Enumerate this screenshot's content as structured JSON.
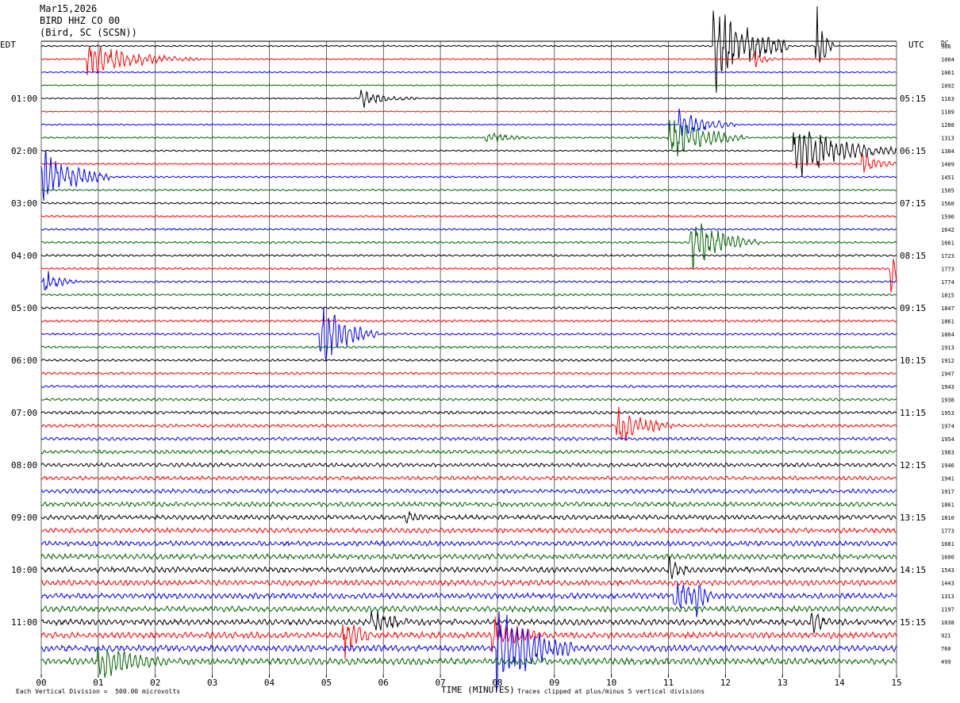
{
  "header": {
    "date": "Mar15,2026",
    "station": "BIRD HHZ CO 00",
    "location": "(Bird, SC (SCSN))"
  },
  "footer": {
    "scale_note": "Each Vertical Division =  500.00 microvolts",
    "clip_note": "Traces clipped at plus/minus 5 vertical divisions",
    "xlabel": "TIME (MINUTES)"
  },
  "colors": {
    "trace_cycle": [
      "#000000",
      "#ff0000",
      "#0000ff",
      "#006400"
    ],
    "grid": "#000000"
  },
  "chart_data": {
    "type": "helicorder",
    "left_axis_label": "EDT",
    "right_axis_label": "UTC",
    "dc_label": "DC",
    "x_ticks": [
      "00",
      "01",
      "02",
      "03",
      "04",
      "05",
      "06",
      "07",
      "08",
      "09",
      "10",
      "11",
      "12",
      "13",
      "14",
      "15"
    ],
    "xlim": [
      0,
      15
    ],
    "minutes_per_line": 15,
    "left_hour_labels": [
      "01:00",
      "02:00",
      "03:00",
      "04:00",
      "05:00",
      "06:00",
      "07:00",
      "08:00",
      "09:00",
      "10:00",
      "11:00"
    ],
    "right_hour_labels": [
      "05:15",
      "06:15",
      "07:15",
      "08:15",
      "09:15",
      "10:15",
      "11:15",
      "12:15",
      "13:15",
      "14:15",
      "15:15"
    ],
    "line_dc_offsets": [
      966,
      1004,
      1061,
      1092,
      1163,
      1189,
      1288,
      1313,
      1384,
      1409,
      1451,
      1505,
      1560,
      1590,
      1642,
      1661,
      1723,
      1773,
      1774,
      1815,
      1847,
      1861,
      1864,
      1913,
      1912,
      1947,
      1943,
      1938,
      1953,
      1974,
      1954,
      1983,
      1946,
      1941,
      1917,
      1861,
      1810,
      1773,
      1681,
      1600,
      1543,
      1443,
      1313,
      1197,
      1038,
      921,
      760,
      499
    ],
    "line_noise_levels": [
      0.8,
      0.8,
      0.7,
      0.7,
      0.7,
      0.7,
      0.8,
      0.9,
      0.9,
      1.0,
      1.0,
      1.0,
      1.1,
      1.1,
      1.1,
      1.2,
      1.2,
      1.2,
      1.2,
      1.2,
      1.2,
      1.3,
      1.3,
      1.3,
      1.4,
      1.4,
      1.4,
      1.5,
      1.7,
      1.8,
      1.9,
      2.0,
      2.2,
      2.3,
      2.4,
      2.6,
      2.7,
      2.8,
      2.9,
      3.0,
      3.1,
      3.2,
      3.2,
      3.3,
      3.4,
      3.5,
      3.6,
      3.8
    ],
    "events": [
      {
        "line": 0,
        "minute": 11.8,
        "amplitude": 14,
        "duration": 1.3
      },
      {
        "line": 0,
        "minute": 13.6,
        "amplitude": 12,
        "duration": 0.3
      },
      {
        "line": 1,
        "minute": 0.8,
        "amplitude": 5,
        "duration": 2.0
      },
      {
        "line": 1,
        "minute": 12.5,
        "amplitude": 4,
        "duration": 0.4
      },
      {
        "line": 4,
        "minute": 5.6,
        "amplitude": 3,
        "duration": 1.0
      },
      {
        "line": 6,
        "minute": 11.2,
        "amplitude": 5,
        "duration": 1.0
      },
      {
        "line": 7,
        "minute": 7.8,
        "amplitude": 2,
        "duration": 1.0
      },
      {
        "line": 7,
        "minute": 11.0,
        "amplitude": 7,
        "duration": 1.4
      },
      {
        "line": 8,
        "minute": 13.2,
        "amplitude": 9,
        "duration": 1.8
      },
      {
        "line": 9,
        "minute": 14.4,
        "amplitude": 4,
        "duration": 0.6
      },
      {
        "line": 10,
        "minute": 0.0,
        "amplitude": 9,
        "duration": 1.2
      },
      {
        "line": 15,
        "minute": 11.4,
        "amplitude": 8,
        "duration": 1.2
      },
      {
        "line": 17,
        "minute": 14.9,
        "amplitude": 10,
        "duration": 0.3
      },
      {
        "line": 18,
        "minute": 0.05,
        "amplitude": 4,
        "duration": 0.6
      },
      {
        "line": 22,
        "minute": 4.9,
        "amplitude": 10,
        "duration": 1.0
      },
      {
        "line": 29,
        "minute": 10.1,
        "amplitude": 7,
        "duration": 1.0
      },
      {
        "line": 36,
        "minute": 6.4,
        "amplitude": 3,
        "duration": 0.4
      },
      {
        "line": 40,
        "minute": 11.0,
        "amplitude": 4,
        "duration": 0.6
      },
      {
        "line": 42,
        "minute": 11.1,
        "amplitude": 7,
        "duration": 0.7
      },
      {
        "line": 42,
        "minute": 11.5,
        "amplitude": 6,
        "duration": 0.4
      },
      {
        "line": 44,
        "minute": 5.8,
        "amplitude": 4,
        "duration": 1.0
      },
      {
        "line": 44,
        "minute": 13.5,
        "amplitude": 4,
        "duration": 0.6
      },
      {
        "line": 45,
        "minute": 5.3,
        "amplitude": 7,
        "duration": 0.6
      },
      {
        "line": 45,
        "minute": 7.9,
        "amplitude": 6,
        "duration": 1.2
      },
      {
        "line": 46,
        "minute": 8.0,
        "amplitude": 14,
        "duration": 1.4
      },
      {
        "line": 47,
        "minute": 1.0,
        "amplitude": 6,
        "duration": 1.5
      }
    ]
  }
}
